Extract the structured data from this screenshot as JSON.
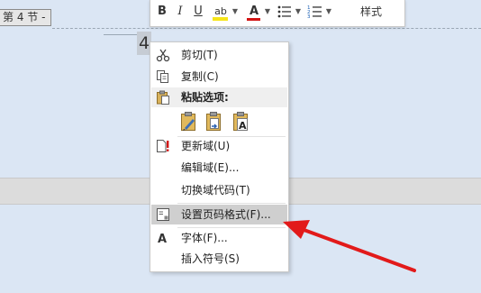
{
  "section_tag": "第 4 节 -",
  "page_number": "4",
  "toolbar": {
    "bold": "B",
    "italic": "I",
    "underline": "U",
    "highlight": "ab",
    "font_color": "A",
    "styles": "样式",
    "highlight_color": "#f6e51a",
    "font_color_value": "#d21414"
  },
  "menu": {
    "cut": "剪切(T)",
    "copy": "复制(C)",
    "paste_options": "粘贴选项:",
    "update_field": "更新域(U)",
    "edit_field": "编辑域(E)...",
    "toggle_field_codes": "切换域代码(T)",
    "format_page_numbers": "设置页码格式(F)...",
    "font": "字体(F)...",
    "insert_symbol": "插入符号(S)"
  },
  "colors": {
    "background": "#dbe6f4",
    "highlight_row": "#cfcfcf",
    "arrow": "#e21a1a"
  }
}
